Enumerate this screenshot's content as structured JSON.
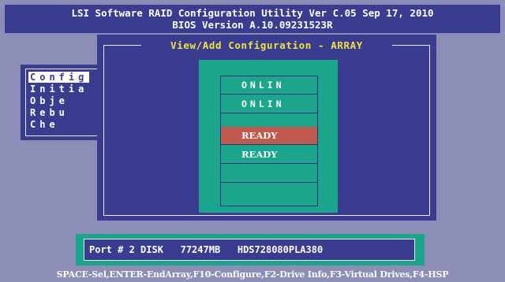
{
  "header": {
    "line1": "LSI Software RAID Configuration Utility Ver C.05 Sep 17, 2010",
    "line2": "BIOS Version   A.10.09231523R"
  },
  "menu": {
    "items": [
      {
        "label": "Config"
      },
      {
        "label": "Initia"
      },
      {
        "label": "Obje"
      },
      {
        "label": "Rebu"
      },
      {
        "label": "Che"
      }
    ]
  },
  "dialog": {
    "title": "View/Add Configuration - ARRAY"
  },
  "array": {
    "slots": [
      {
        "label": "ONLIN",
        "state": "online"
      },
      {
        "label": "ONLIN",
        "state": "online"
      },
      {
        "label": "READY",
        "state": "ready",
        "highlighted": true
      },
      {
        "label": "READY",
        "state": "ready"
      },
      {
        "label": "",
        "state": "empty"
      },
      {
        "label": "",
        "state": "empty"
      }
    ]
  },
  "status": {
    "text": "Port # 2 DISK   77247MB   HDS728080PLA380"
  },
  "footer": {
    "hint": "SPACE-Sel,ENTER-EndArray,F10-Configure,F2-Drive Info,F3-Virtual Drives,F4-HSP"
  },
  "colors": {
    "background": "#8c8eb8",
    "panel_blue": "#3a3d8f",
    "teal": "#1aa58c",
    "highlight": "#c05a4f",
    "title_yellow": "#f0e040"
  }
}
